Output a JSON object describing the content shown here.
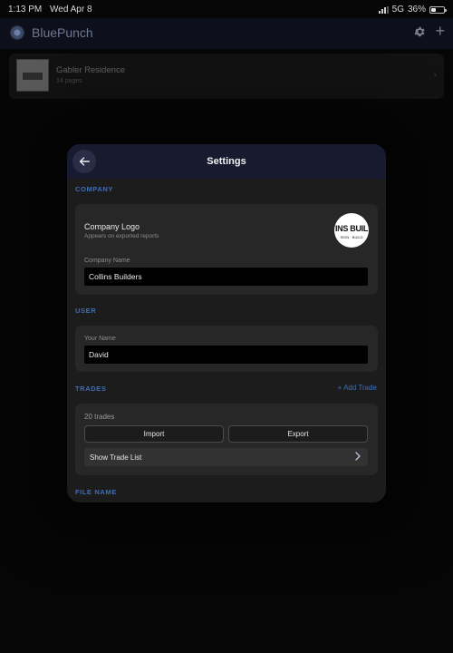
{
  "status_bar": {
    "time": "1:13 PM",
    "date": "Wed Apr 8",
    "network": "5G",
    "battery": "36%",
    "battery_level": 0.36
  },
  "app": {
    "title": "BluePunch",
    "icons": [
      "app-logo-icon",
      "gear-icon",
      "plus-icon"
    ]
  },
  "projects": [
    {
      "name": "Gabler Residence",
      "pages": "14 pages"
    }
  ],
  "settings": {
    "title": "Settings",
    "company": {
      "section_label": "COMPANY",
      "logo_label": "Company Logo",
      "logo_sublabel": "Appears on exported reports",
      "logo_text": "INS BUIL",
      "logo_subtext": "SIGN · BUILD",
      "company_name_label": "Company Name",
      "company_name_value": "Collins Builders"
    },
    "user": {
      "section_label": "USER",
      "name_label": "Your Name",
      "name_value": "David"
    },
    "trades": {
      "section_label": "TRADES",
      "add_label": "+ Add Trade",
      "count": "20 trades",
      "import_label": "Import",
      "export_label": "Export",
      "show_list_label": "Show Trade List"
    },
    "file_name": {
      "section_label": "FILE NAME"
    }
  },
  "colors": {
    "accent": "#3d6fb8",
    "modal_header": "#181a30",
    "modal_bg": "#1c1c1d",
    "group_bg": "#272728"
  }
}
